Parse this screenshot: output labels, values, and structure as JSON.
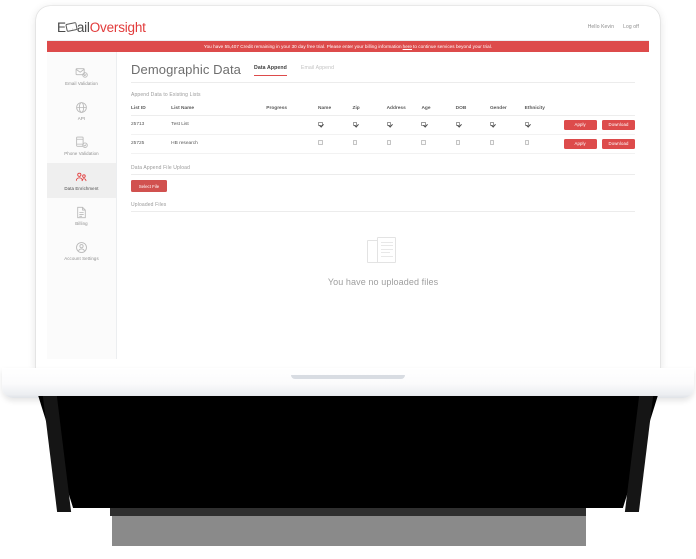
{
  "brand": {
    "text_dark_1": "E",
    "icon": "envelope-glyph",
    "text_dark_2": "ail",
    "text_red": "Oversight",
    "color_red": "#e23b3b",
    "color_dark": "#4a4a4a"
  },
  "topbar": {
    "greeting": "Hello Kevin",
    "logoff": "Log off"
  },
  "alert": {
    "prefix": "You have 55,407 Credit remaining in your 30 day free trial.  Please enter your billing information",
    "link": "here",
    "suffix": "to continue services beyond your trial.",
    "bg_color": "#dd4b4b"
  },
  "sidebar": {
    "items": [
      {
        "label": "Email Validation",
        "icon": "email-check-icon",
        "active": false
      },
      {
        "label": "API",
        "icon": "api-globe-icon",
        "active": false
      },
      {
        "label": "Phone Validation",
        "icon": "phone-check-icon",
        "active": false
      },
      {
        "label": "Data Enrichment",
        "icon": "data-enrich-icon",
        "active": true
      },
      {
        "label": "Billing",
        "icon": "invoice-icon",
        "active": false
      },
      {
        "label": "Account Settings",
        "icon": "user-circle-icon",
        "active": false
      }
    ]
  },
  "page": {
    "title": "Demographic Data",
    "tabs": [
      {
        "label": "Data Append",
        "active": true
      },
      {
        "label": "Email Append",
        "active": false
      }
    ]
  },
  "append_section": {
    "title": "Append Data to Existing Lists",
    "columns": [
      "List ID",
      "List Name",
      "Progress",
      "Name",
      "Zip",
      "Address",
      "Age",
      "DOB",
      "Gender",
      "Ethnicity"
    ],
    "rows": [
      {
        "list_id": "25713",
        "list_name": "Test List",
        "progress": "",
        "checks": {
          "name": true,
          "zip": true,
          "address": true,
          "age": true,
          "dob": true,
          "gender": true,
          "ethnicity": true
        },
        "apply_label": "Apply",
        "download_label": "Download"
      },
      {
        "list_id": "25725",
        "list_name": "HB research",
        "progress": "",
        "checks": {
          "name": false,
          "zip": false,
          "address": false,
          "age": false,
          "dob": false,
          "gender": false,
          "ethnicity": false
        },
        "apply_label": "Apply",
        "download_label": "Download"
      }
    ]
  },
  "upload_section": {
    "title": "Data Append File Upload",
    "select_file_label": "Select File"
  },
  "uploaded_section": {
    "title": "Uploaded Files",
    "empty_text": "You have no uploaded files",
    "empty_icon": "documents-icon"
  }
}
